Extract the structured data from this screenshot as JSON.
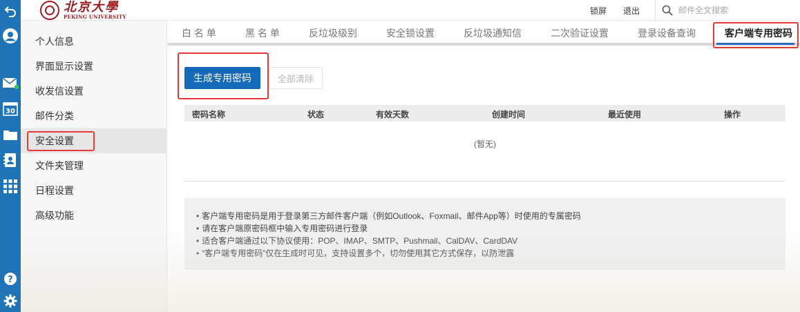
{
  "rail": {
    "icons": [
      "back-arrow-icon",
      "user-avatar-icon",
      "mail-icon",
      "calendar-icon",
      "folder-icon",
      "contacts-icon",
      "apps-grid-icon",
      "help-icon",
      "settings-gear-icon"
    ],
    "calendar_day": "30",
    "help_glyph": "?"
  },
  "header": {
    "logo_cn": "北京大學",
    "logo_en": "PEKING UNIVERSITY",
    "lock_label": "锁屏",
    "logout_label": "退出",
    "search_placeholder": "邮件全文搜索"
  },
  "sidebar": {
    "items": [
      {
        "label": "个人信息"
      },
      {
        "label": "界面显示设置"
      },
      {
        "label": "收发信设置"
      },
      {
        "label": "邮件分类"
      },
      {
        "label": "安全设置"
      },
      {
        "label": "文件夹管理"
      },
      {
        "label": "日程设置"
      },
      {
        "label": "高级功能"
      }
    ]
  },
  "tabs": [
    {
      "label": "白 名 单"
    },
    {
      "label": "黑 名 单"
    },
    {
      "label": "反垃圾级别"
    },
    {
      "label": "安全锁设置"
    },
    {
      "label": "反垃圾通知信"
    },
    {
      "label": "二次验证设置"
    },
    {
      "label": "登录设备查询"
    },
    {
      "label": "客户端专用密码"
    }
  ],
  "actions": {
    "generate_label": "生成专用密码",
    "clear_label": "全部清除"
  },
  "table": {
    "columns": [
      "密码名称",
      "状态",
      "有效天数",
      "创建时间",
      "最近使用",
      "操作"
    ],
    "empty_text": "(暂无)"
  },
  "notes": [
    "客户端专用密码是用于登录第三方邮件客户端（例如Outlook、Foxmail、邮件App等）时使用的专属密码",
    "请在客户端原密码框中输入专用密码进行登录",
    "适合客户端通过以下协议使用：POP、IMAP、SMTP、Pushmail、CalDAV、CardDAV",
    "“客户端专用密码”仅在生成时可见，支持设置多个，切勿使用其它方式保存，以防泄露"
  ],
  "colors": {
    "rail": "#1f73b7",
    "primary_button": "#1469b8",
    "highlight_box": "#e53935",
    "active_tab_underline": "#2b6cc4",
    "brand": "#9b1b1f",
    "online_dot": "#3ac45a"
  }
}
